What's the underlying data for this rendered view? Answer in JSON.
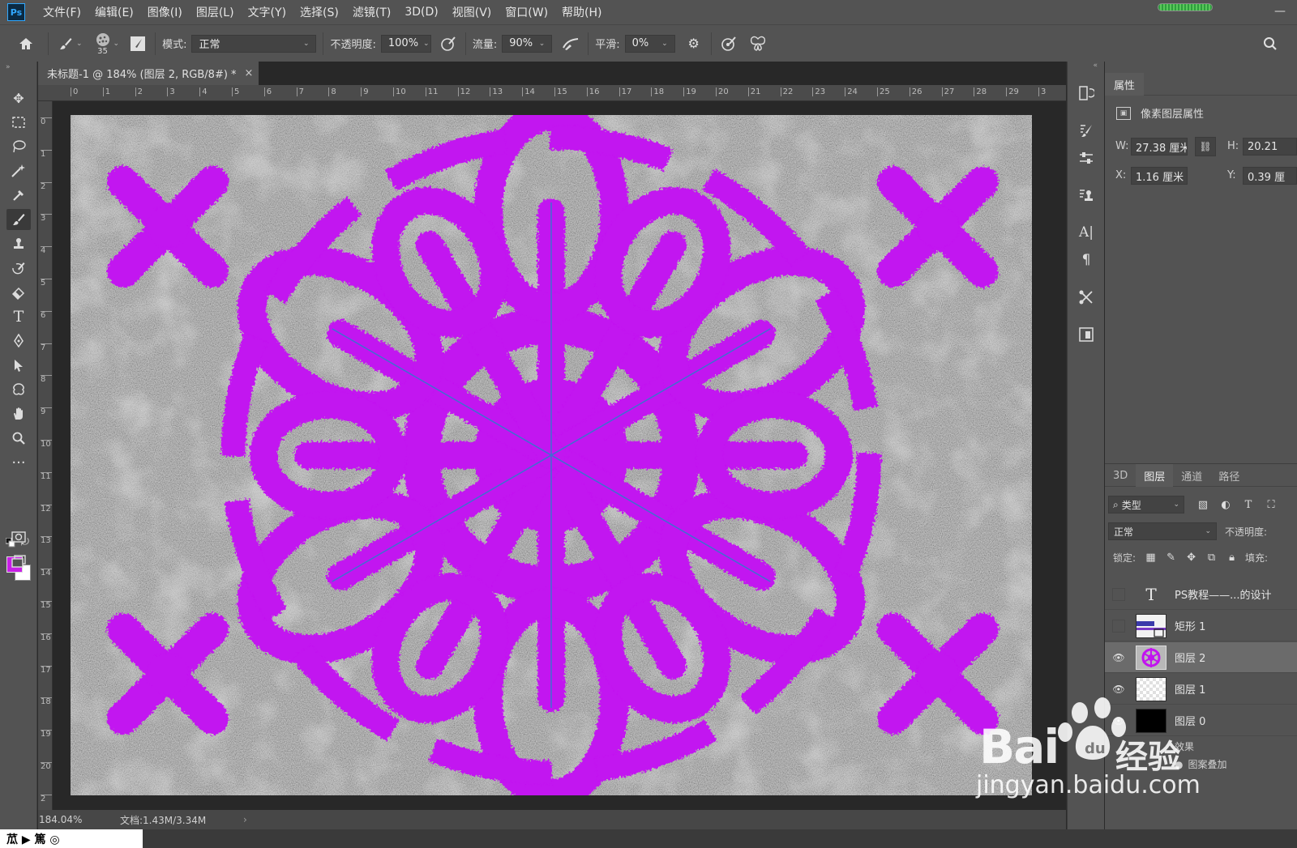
{
  "menubar": {
    "logo": "Ps",
    "items": [
      "文件(F)",
      "编辑(E)",
      "图像(I)",
      "图层(L)",
      "文字(Y)",
      "选择(S)",
      "滤镜(T)",
      "3D(D)",
      "视图(V)",
      "窗口(W)",
      "帮助(H)"
    ]
  },
  "options": {
    "brush_size": "35",
    "mode_label": "模式:",
    "mode_value": "正常",
    "opacity_label": "不透明度:",
    "opacity_value": "100%",
    "flow_label": "流量:",
    "flow_value": "90%",
    "smooth_label": "平滑:",
    "smooth_value": "0%"
  },
  "document": {
    "tab_title": "未标题-1 @ 184% (图层 2, RGB/8#) *",
    "close": "×",
    "ruler_top": [
      "0",
      "1",
      "2",
      "3",
      "4",
      "5",
      "6",
      "7",
      "8",
      "9",
      "10",
      "11",
      "12",
      "13",
      "14",
      "15",
      "16",
      "17",
      "18",
      "19",
      "20",
      "21",
      "22",
      "23",
      "24",
      "25",
      "26",
      "27",
      "28",
      "29",
      "3"
    ],
    "ruler_left": [
      "0",
      "1",
      "2",
      "3",
      "4",
      "5",
      "6",
      "7",
      "8",
      "9",
      "10",
      "11",
      "12",
      "13",
      "14",
      "15",
      "16",
      "17",
      "18",
      "19",
      "20",
      "2"
    ],
    "status_zoom": "184.04%",
    "status_doc": "文档:1.43M/3.34M",
    "status_arrow": "›"
  },
  "colors": {
    "foreground": "#c81ee6",
    "background": "#ffffff",
    "snowflake": "#c212f0",
    "symmetry_guide": "#3f6fd0"
  },
  "properties": {
    "tab": "属性",
    "type": "像素图层属性",
    "w_label": "W:",
    "w_value": "27.38 厘米",
    "h_label": "H:",
    "h_value": "20.21",
    "x_label": "X:",
    "x_value": "1.16 厘米",
    "y_label": "Y:",
    "y_value": "0.39 厘"
  },
  "layers_panel": {
    "tabs": [
      "3D",
      "图层",
      "通道",
      "路径"
    ],
    "filter": "类型",
    "blend_mode": "正常",
    "opacity_label": "不透明度:",
    "lock_label": "锁定:",
    "fill_label": "填充:",
    "layers": [
      {
        "name": "PS教程——...的设计",
        "visible": false,
        "kind": "text"
      },
      {
        "name": "矩形 1",
        "visible": false,
        "kind": "shape"
      },
      {
        "name": "图层 2",
        "visible": true,
        "kind": "snowflake",
        "selected": true
      },
      {
        "name": "图层 1",
        "visible": true,
        "kind": "transparent"
      },
      {
        "name": "图层 0",
        "visible": true,
        "kind": "black"
      }
    ],
    "effects_label": "效果",
    "effect_item": "图案叠加"
  },
  "watermark": {
    "brand": "Bai",
    "brand_suffix": "du",
    "jingyan": "经验",
    "url": "jingyan.baidu.com"
  },
  "bottom_fragment": "苽 ▶ 篤 ◎"
}
